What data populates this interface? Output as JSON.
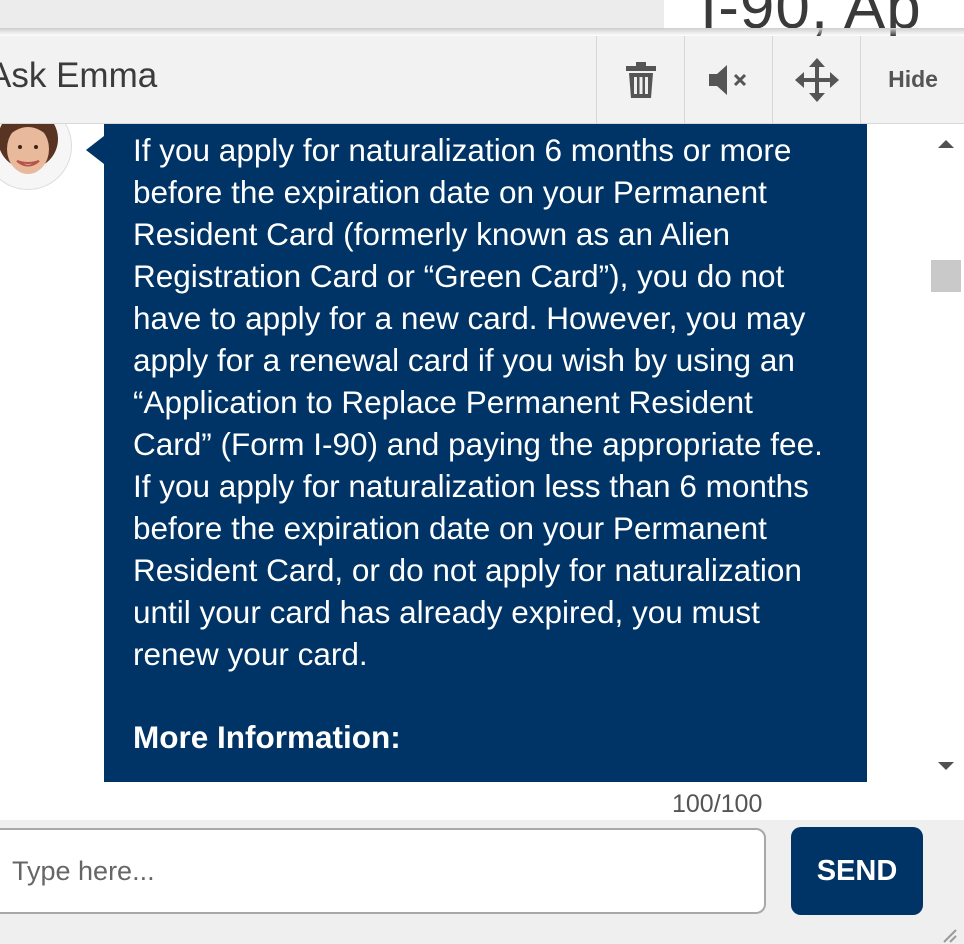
{
  "background": {
    "heading": "I-90, Ap"
  },
  "chat": {
    "title": "Ask Emma",
    "toolbar": {
      "clear_icon": "trash-icon",
      "mute_icon": "speaker-muted-icon",
      "move_icon": "move-arrows-icon",
      "hide_label": "Hide"
    },
    "message": {
      "text": "If you apply for naturalization 6 months or more before the expiration date on your Permanent Resident Card (formerly known as an Alien Registration Card or “Green Card”), you do not have to apply for a new card. However, you may apply for a renewal card if you wish by using an “Application to Replace Permanent Resident Card” (Form I-90) and paying the appropriate fee. If you apply for naturalization less than 6 months before the expiration date on your Permanent Resident Card, or do not apply for naturalization until your card has already expired, you must renew your card.",
      "more_info": "More Information:"
    },
    "counter": "100/100",
    "input_placeholder": "Type here...",
    "send_label": "SEND"
  },
  "colors": {
    "accent": "#003466",
    "header_bg": "#f2f2f2",
    "scroll_thumb": "#c9c9c9"
  }
}
